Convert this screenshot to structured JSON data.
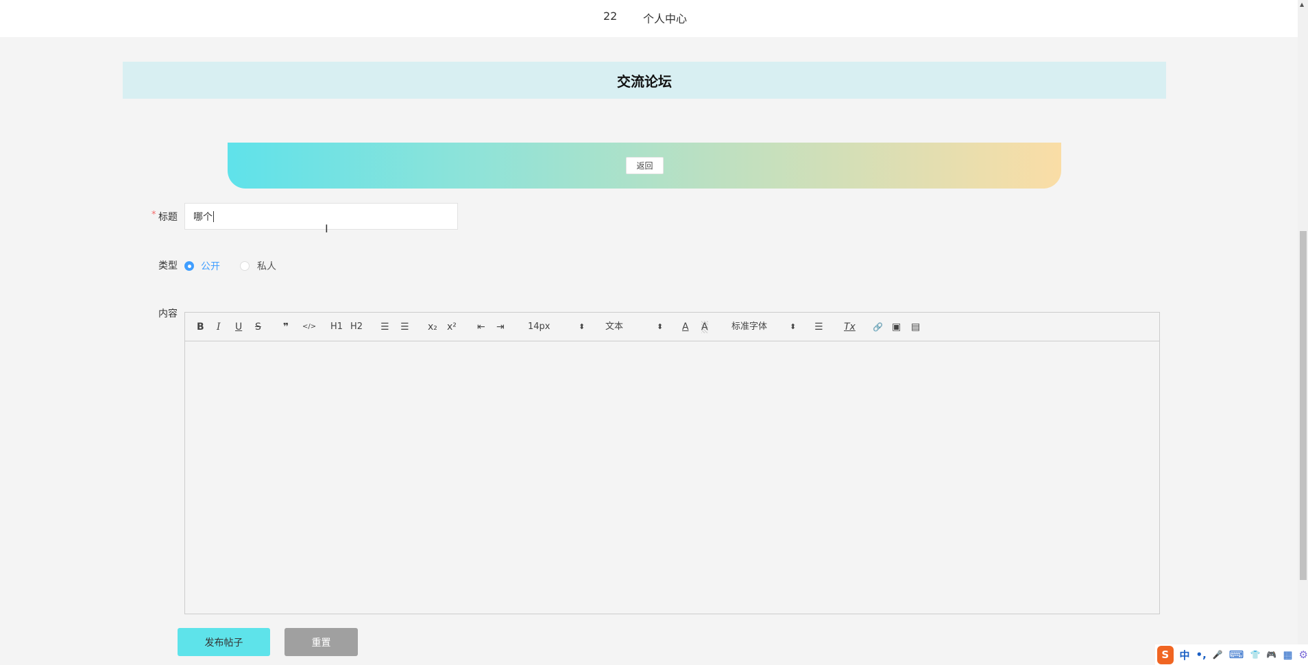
{
  "header": {
    "number": "22",
    "personal_center": "个人中心"
  },
  "banner": {
    "title": "交流论坛"
  },
  "back_button": "返回",
  "form": {
    "title_label": "标题",
    "required_mark": "*",
    "title_value": "哪个",
    "type_label": "类型",
    "type_options": [
      {
        "label": "公开",
        "selected": true
      },
      {
        "label": "私人",
        "selected": false
      }
    ],
    "content_label": "内容",
    "toolbar": {
      "size": "14px",
      "header": "文本",
      "font": "标准字体",
      "bold": "B",
      "italic": "I",
      "underline": "U",
      "strike": "S",
      "quote": "❞",
      "code": "</>",
      "h1": "H1",
      "h2": "H2",
      "ordered": "☰",
      "bullet": "☰",
      "sub": "x₂",
      "sup": "x²",
      "outdent": "⇤",
      "indent": "⇥",
      "color": "A",
      "background": "A",
      "align": "☰",
      "clean": "Tx",
      "link": "🔗",
      "image": "▣",
      "video": "▤",
      "arrow": "⬍"
    }
  },
  "buttons": {
    "submit": "发布帖子",
    "reset": "重置"
  },
  "ime": {
    "logo": "S",
    "mode": "中",
    "punct": "•,",
    "mic": "🎤",
    "keyboard": "⌨",
    "skin": "👕",
    "game": "🎮",
    "apps": "▦",
    "settings": "⚙"
  },
  "colors": {
    "accent": "#409eff",
    "submit": "#5ee3ea",
    "reset": "#a0a0a0"
  }
}
